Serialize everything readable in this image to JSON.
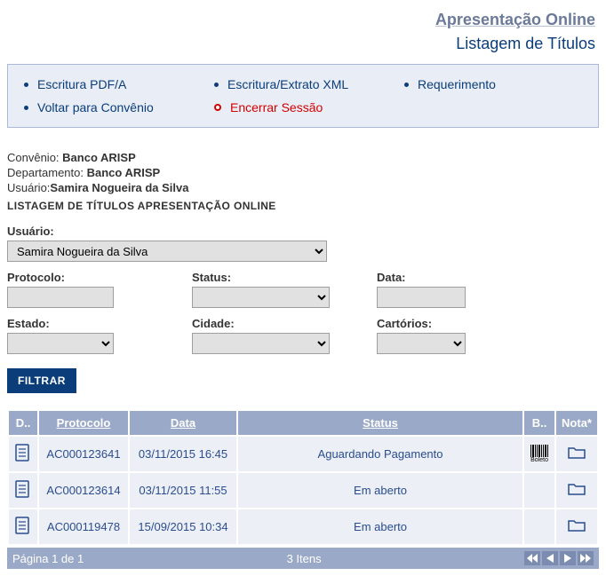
{
  "header": {
    "title": "Apresentação Online",
    "subtitle": "Listagem de Títulos"
  },
  "menu": {
    "items": [
      {
        "label": "Escritura PDF/A",
        "style": "blue"
      },
      {
        "label": "Escritura/Extrato XML",
        "style": "blue"
      },
      {
        "label": "Requerimento",
        "style": "blue"
      },
      {
        "label": "Voltar para Convênio",
        "style": "blue"
      },
      {
        "label": "Encerrar Sessão",
        "style": "red"
      }
    ]
  },
  "info": {
    "convenio_label": "Convênio: ",
    "convenio_value": "Banco ARISP",
    "departamento_label": "Departamento: ",
    "departamento_value": "Banco ARISP",
    "usuario_label": "Usuário:",
    "usuario_value": "Samira Nogueira da Silva",
    "section_title": "LISTAGEM DE TÍTULOS APRESENTAÇÃO ONLINE"
  },
  "filters": {
    "usuario": {
      "label": "Usuário:",
      "value": "Samira Nogueira da Silva"
    },
    "protocolo": {
      "label": "Protocolo:",
      "value": ""
    },
    "status": {
      "label": "Status:",
      "value": ""
    },
    "data": {
      "label": "Data:",
      "value": ""
    },
    "estado": {
      "label": "Estado:",
      "value": ""
    },
    "cidade": {
      "label": "Cidade:",
      "value": ""
    },
    "cartorios": {
      "label": "Cartórios:",
      "value": ""
    },
    "filter_btn": "FILTRAR"
  },
  "grid": {
    "headers": {
      "doc": "D..",
      "protocolo": "Protocolo",
      "data": "Data",
      "status": "Status",
      "boleto": "B..",
      "nota": "Nota*"
    },
    "rows": [
      {
        "protocolo": "AC000123641",
        "data": "03/11/2015 16:45",
        "status": "Aguardando Pagamento",
        "boleto": true
      },
      {
        "protocolo": "AC000123614",
        "data": "03/11/2015 11:55",
        "status": "Em aberto",
        "boleto": false
      },
      {
        "protocolo": "AC000119478",
        "data": "15/09/2015 10:34",
        "status": "Em aberto",
        "boleto": false
      }
    ]
  },
  "pager": {
    "page_text": "Página 1  de  1",
    "count_text": "3 Itens"
  },
  "icons": {
    "boleto_label": "Boleto"
  },
  "colors": {
    "brand": "#0a3d7a",
    "header_grid": "#9aa9c7",
    "danger": "#d40000"
  }
}
